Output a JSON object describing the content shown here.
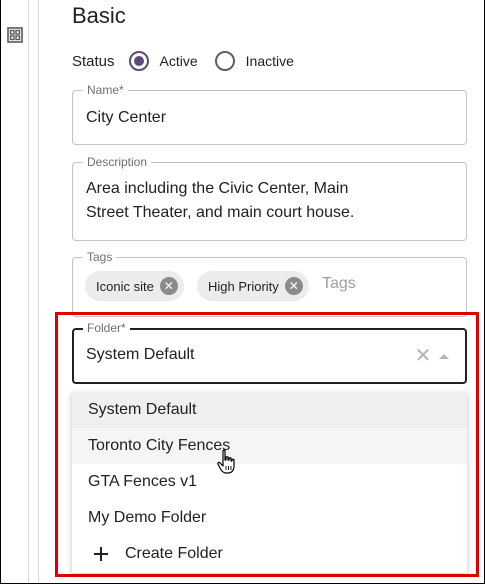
{
  "form": {
    "section_title": "Basic",
    "status": {
      "label": "Status",
      "options": [
        "Active",
        "Inactive"
      ],
      "selected": "Active"
    },
    "name": {
      "label": "Name*",
      "value": "City Center"
    },
    "description": {
      "label": "Description",
      "value": "Area including the Civic Center, Main Street Theater, and main court house."
    },
    "tags": {
      "label": "Tags",
      "chips": [
        "Iconic site",
        "High Priority"
      ],
      "placeholder": "Tags"
    },
    "folder": {
      "label": "Folder*",
      "value": "System Default",
      "options": [
        "System Default",
        "Toronto City Fences",
        "GTA Fences v1",
        "My Demo Folder"
      ],
      "selected_option": "System Default",
      "hovered_option": "Toronto City Fences",
      "create_label": "Create Folder"
    }
  },
  "colors": {
    "radio_accent": "#5c4a7a",
    "highlight": "#e00000"
  },
  "icons": {
    "rail": "dashboard-grid-icon",
    "clear": "close-icon",
    "expand": "chevron-up-icon",
    "chip_remove": "cancel-circle-icon",
    "create": "plus-icon",
    "cursor": "hand-pointer-icon"
  }
}
